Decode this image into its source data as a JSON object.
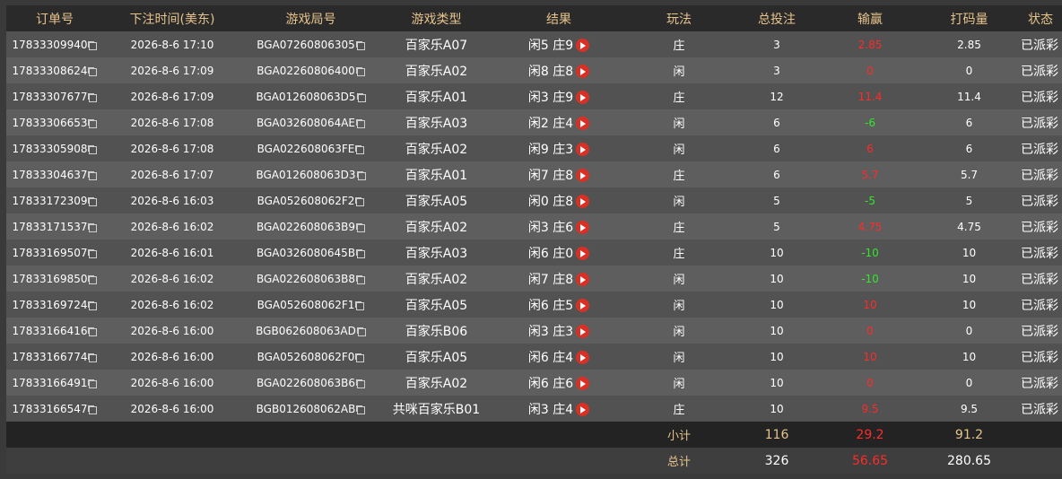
{
  "headers": [
    "订单号",
    "下注时间(美东)",
    "游戏局号",
    "游戏类型",
    "结果",
    "玩法",
    "总投注",
    "输赢",
    "打码量",
    "状态"
  ],
  "rows": [
    {
      "order": "17833309940",
      "time": "2026-8-6 17:10",
      "round": "BGA07260806305",
      "game": "百家乐A07",
      "result": "闲5 庄9",
      "play": "庄",
      "bet": "3",
      "win": "2.85",
      "win_color": "neg",
      "valid": "2.85",
      "status": "已派彩"
    },
    {
      "order": "17833308624",
      "time": "2026-8-6 17:09",
      "round": "BGA02260806400",
      "game": "百家乐A02",
      "result": "闲8 庄8",
      "play": "闲",
      "bet": "3",
      "win": "0",
      "win_color": "neg",
      "valid": "0",
      "status": "已派彩"
    },
    {
      "order": "17833307677",
      "time": "2026-8-6 17:09",
      "round": "BGA012608063D5",
      "game": "百家乐A01",
      "result": "闲3 庄9",
      "play": "庄",
      "bet": "12",
      "win": "11.4",
      "win_color": "neg",
      "valid": "11.4",
      "status": "已派彩"
    },
    {
      "order": "17833306653",
      "time": "2026-8-6 17:08",
      "round": "BGA032608064AE",
      "game": "百家乐A03",
      "result": "闲2 庄4",
      "play": "闲",
      "bet": "6",
      "win": "-6",
      "win_color": "pos",
      "valid": "6",
      "status": "已派彩"
    },
    {
      "order": "17833305908",
      "time": "2026-8-6 17:08",
      "round": "BGA022608063FE",
      "game": "百家乐A02",
      "result": "闲9 庄3",
      "play": "闲",
      "bet": "6",
      "win": "6",
      "win_color": "neg",
      "valid": "6",
      "status": "已派彩"
    },
    {
      "order": "17833304637",
      "time": "2026-8-6 17:07",
      "round": "BGA012608063D3",
      "game": "百家乐A01",
      "result": "闲7 庄8",
      "play": "庄",
      "bet": "6",
      "win": "5.7",
      "win_color": "neg",
      "valid": "5.7",
      "status": "已派彩"
    },
    {
      "order": "17833172309",
      "time": "2026-8-6 16:03",
      "round": "BGA052608062F2",
      "game": "百家乐A05",
      "result": "闲0 庄8",
      "play": "闲",
      "bet": "5",
      "win": "-5",
      "win_color": "pos",
      "valid": "5",
      "status": "已派彩"
    },
    {
      "order": "17833171537",
      "time": "2026-8-6 16:02",
      "round": "BGA022608063B9",
      "game": "百家乐A02",
      "result": "闲3 庄6",
      "play": "庄",
      "bet": "5",
      "win": "4.75",
      "win_color": "neg",
      "valid": "4.75",
      "status": "已派彩"
    },
    {
      "order": "17833169507",
      "time": "2026-8-6 16:01",
      "round": "BGA0326080645B",
      "game": "百家乐A03",
      "result": "闲6 庄0",
      "play": "庄",
      "bet": "10",
      "win": "-10",
      "win_color": "pos",
      "valid": "10",
      "status": "已派彩"
    },
    {
      "order": "17833169850",
      "time": "2026-8-6 16:02",
      "round": "BGA022608063B8",
      "game": "百家乐A02",
      "result": "闲7 庄8",
      "play": "闲",
      "bet": "10",
      "win": "-10",
      "win_color": "pos",
      "valid": "10",
      "status": "已派彩"
    },
    {
      "order": "17833169724",
      "time": "2026-8-6 16:02",
      "round": "BGA052608062F1",
      "game": "百家乐A05",
      "result": "闲6 庄5",
      "play": "闲",
      "bet": "10",
      "win": "10",
      "win_color": "neg",
      "valid": "10",
      "status": "已派彩"
    },
    {
      "order": "17833166416",
      "time": "2026-8-6 16:00",
      "round": "BGB062608063AD",
      "game": "百家乐B06",
      "result": "闲3 庄3",
      "play": "闲",
      "bet": "10",
      "win": "0",
      "win_color": "neg",
      "valid": "0",
      "status": "已派彩"
    },
    {
      "order": "17833166774",
      "time": "2026-8-6 16:00",
      "round": "BGA052608062F0",
      "game": "百家乐A05",
      "result": "闲6 庄4",
      "play": "闲",
      "bet": "10",
      "win": "10",
      "win_color": "neg",
      "valid": "10",
      "status": "已派彩"
    },
    {
      "order": "17833166491",
      "time": "2026-8-6 16:00",
      "round": "BGA022608063B6",
      "game": "百家乐A02",
      "result": "闲6 庄6",
      "play": "闲",
      "bet": "10",
      "win": "0",
      "win_color": "neg",
      "valid": "0",
      "status": "已派彩"
    },
    {
      "order": "17833166547",
      "time": "2026-8-6 16:00",
      "round": "BGB012608062AB",
      "game": "共咪百家乐B01",
      "result": "闲3 庄4",
      "play": "庄",
      "bet": "10",
      "win": "9.5",
      "win_color": "neg",
      "valid": "9.5",
      "status": "已派彩"
    }
  ],
  "subtotal": {
    "label": "小计",
    "bet": "116",
    "win": "29.2",
    "valid": "91.2"
  },
  "total": {
    "label": "总计",
    "bet": "326",
    "win": "56.65",
    "valid": "280.65"
  },
  "colors": {
    "header_bg": "#2a2a2a",
    "gold": "#e6c38c",
    "loss_red": "#ff2a2a",
    "win_green": "#2ee82e",
    "play_btn": "#d93025"
  },
  "icons": {
    "copy": "copy-icon",
    "play": "play-icon",
    "refresh": "refresh-icon"
  }
}
